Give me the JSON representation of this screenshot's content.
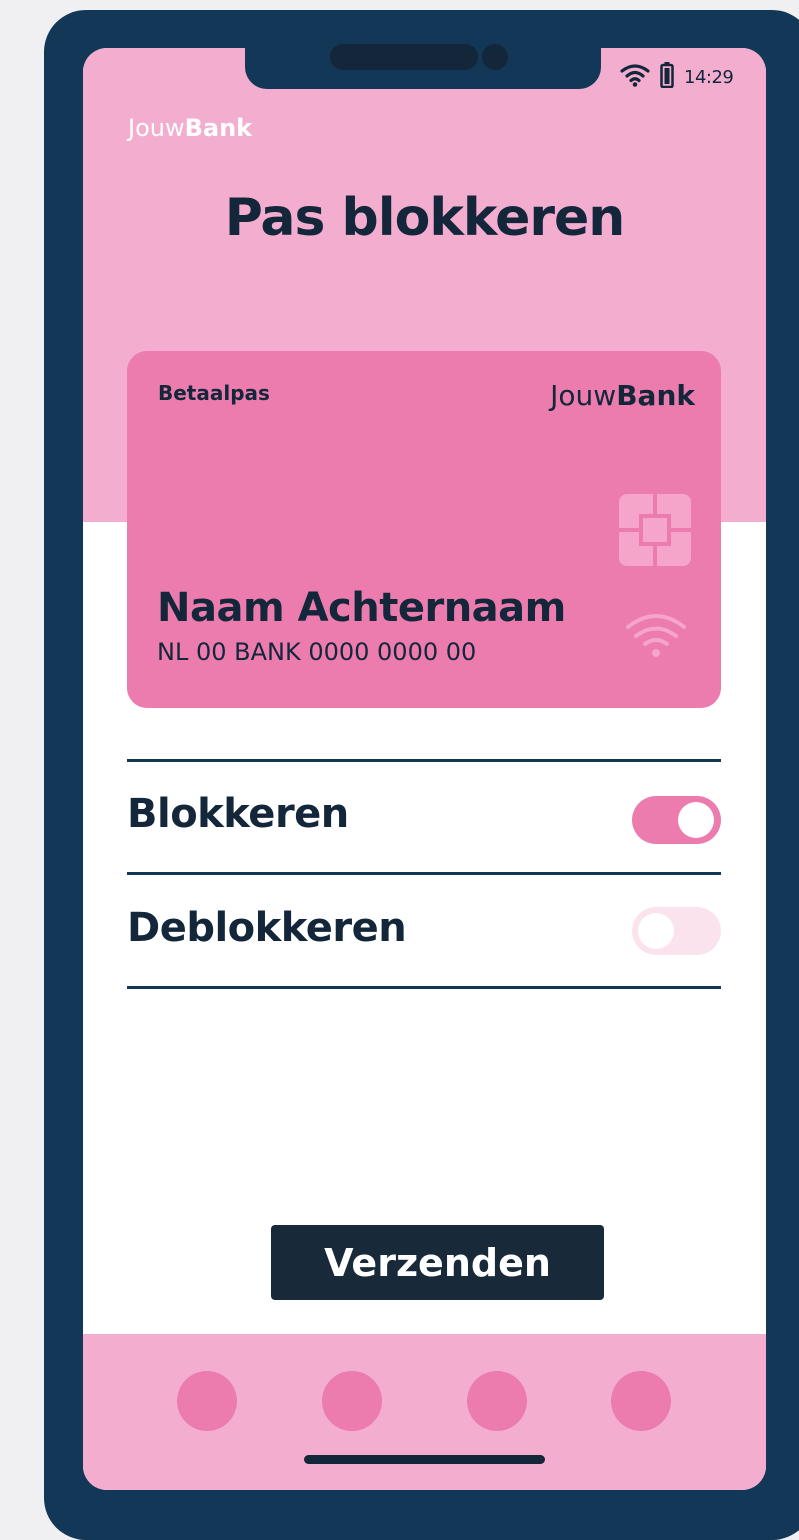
{
  "status_bar": {
    "time": "14:29",
    "wifi_icon": "wifi-icon",
    "battery_icon": "battery-icon"
  },
  "app": {
    "brand_light": "Jouw",
    "brand_bold": "Bank"
  },
  "page": {
    "title": "Pas blokkeren"
  },
  "card": {
    "type_label": "Betaalpas",
    "brand_light": "Jouw",
    "brand_bold": "Bank",
    "holder_name": "Naam Achternaam",
    "iban": "NL 00 BANK 0000 0000 00",
    "chip_icon": "chip-icon",
    "contactless_icon": "contactless-icon"
  },
  "options": [
    {
      "label": "Blokkeren",
      "enabled": true
    },
    {
      "label": "Deblokkeren",
      "enabled": false
    }
  ],
  "submit": {
    "label": "Verzenden"
  },
  "colors": {
    "frame": "#133757",
    "header_band": "#f3adcf",
    "card": "#ec7cae",
    "text": "#13263a",
    "toggle_on": "#ec7cae",
    "toggle_off": "#fbe3ee",
    "button": "#18293a"
  }
}
